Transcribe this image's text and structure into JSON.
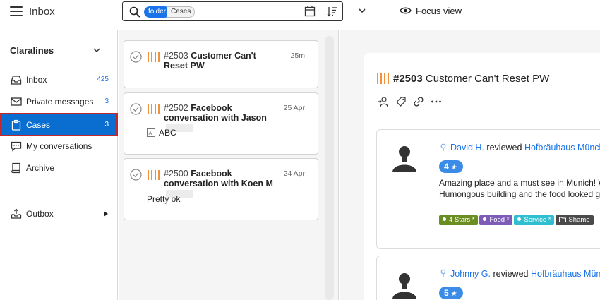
{
  "topbar": {
    "title": "Inbox",
    "search": {
      "chip_key": "folder",
      "chip_value": "Cases"
    },
    "focus_label": "Focus view"
  },
  "sidebar": {
    "org_name": "Claralines",
    "items": [
      {
        "label": "Inbox",
        "count": "425",
        "icon": "inbox-icon"
      },
      {
        "label": "Private messages",
        "count": "3",
        "icon": "envelope-icon"
      },
      {
        "label": "Cases",
        "count": "3",
        "icon": "clipboard-icon",
        "active": true
      },
      {
        "label": "My conversations",
        "count": "",
        "icon": "chat-icon"
      },
      {
        "label": "Archive",
        "count": "",
        "icon": "book-icon"
      }
    ],
    "outbox": {
      "label": "Outbox",
      "icon": "outbox-icon"
    }
  },
  "cases": [
    {
      "id": "#2503",
      "title": "Customer Can't Reset PW",
      "time": "25m"
    },
    {
      "id": "#2502",
      "title": "Facebook conversation with Jason",
      "time": "25 Apr",
      "sub": "ABC"
    },
    {
      "id": "#2500",
      "title": "Facebook conversation with Koen M",
      "time": "24 Apr",
      "sub": "Pretty ok"
    }
  ],
  "detail": {
    "case_id": "#2503",
    "case_title": "Customer Can't Reset PW",
    "reviews": [
      {
        "author": "David H.",
        "verb": "reviewed",
        "place": "Hofbräuhaus Münche",
        "rating": "4",
        "text_line1": "Amazing place and a must see in Munich! W",
        "text_line2": "Humongous building and the food looked g",
        "labels": [
          {
            "text": "4 Stars *",
            "color": "#6b8e23"
          },
          {
            "text": "Food *",
            "color": "#7d5cb8"
          },
          {
            "text": "Service *",
            "color": "#2fbfd0"
          },
          {
            "text": "Shame",
            "color": "#4a4a4a"
          }
        ]
      },
      {
        "author": "Johnny G.",
        "verb": "reviewed",
        "place": "Hofbräuhaus Münche",
        "rating": "5"
      }
    ]
  },
  "colors": {
    "accent": "#1a73e8",
    "active_nav": "#0a6ed1",
    "active_border": "#c0282d",
    "priority": "#f0913c"
  }
}
